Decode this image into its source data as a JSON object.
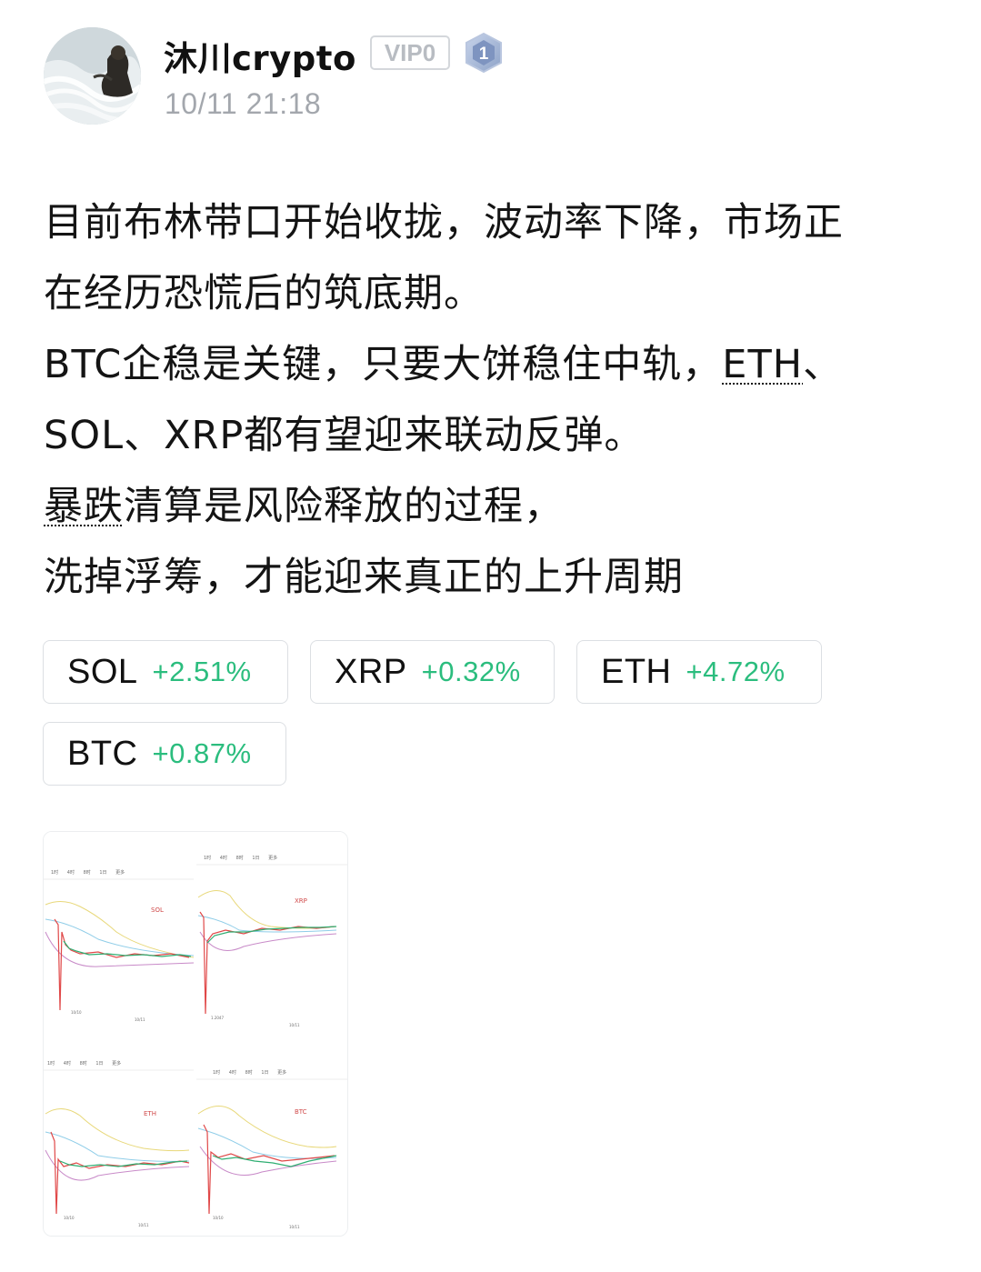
{
  "header": {
    "username": "沐川crypto",
    "vip_label": "VIP0",
    "level": "1",
    "timestamp": "10/11 21:18"
  },
  "post": {
    "line1": "目前布林带口开始收拢，波动率下降，市场正",
    "line2": "在经历恐慌后的筑底期。",
    "line3_pre": "BTC企稳是关键，只要大饼稳住中轨，",
    "line3_link": "ETH",
    "line3_post": "、",
    "line4": "SOL、XRP都有望迎来联动反弹。",
    "line5_link": "暴跌",
    "line5_post": "清算是风险释放的过程，",
    "line6": "洗掉浮筹，才能迎来真正的上升周期"
  },
  "tickers": [
    {
      "symbol": "SOL",
      "change": "+2.51%"
    },
    {
      "symbol": "XRP",
      "change": "+0.32%"
    },
    {
      "symbol": "ETH",
      "change": "+4.72%"
    },
    {
      "symbol": "BTC",
      "change": "+0.87%"
    }
  ],
  "colors": {
    "positive": "#2bbd7e",
    "muted": "#a3a7ad",
    "text": "#141414"
  },
  "chart_image": {
    "panels": [
      {
        "label": "SOL"
      },
      {
        "label": "XRP"
      },
      {
        "label": "ETH"
      },
      {
        "label": "BTC"
      }
    ],
    "timeframes": [
      "1时",
      "4时",
      "8时",
      "1日",
      "更多",
      "指标",
      "画线"
    ]
  }
}
